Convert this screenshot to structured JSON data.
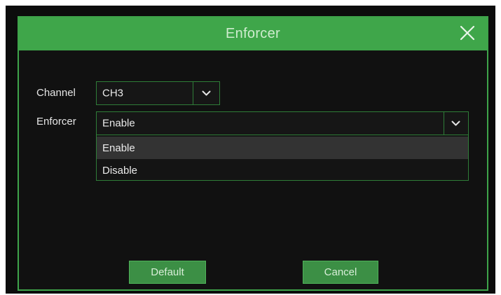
{
  "dialog": {
    "title": "Enforcer",
    "close_icon": "close-icon"
  },
  "fields": {
    "channel": {
      "label": "Channel",
      "value": "CH3",
      "icon": "chevron-down-icon"
    },
    "enforcer": {
      "label": "Enforcer",
      "value": "Enable",
      "icon": "chevron-down-icon",
      "options": [
        "Enable",
        "Disable"
      ],
      "highlighted_option": "Enable"
    }
  },
  "buttons": {
    "default_label": "Default",
    "cancel_label": "Cancel"
  },
  "colors": {
    "accent_green": "#3fa64a",
    "button_green": "#3c8f45",
    "background": "#111111",
    "highlight": "#333333"
  }
}
